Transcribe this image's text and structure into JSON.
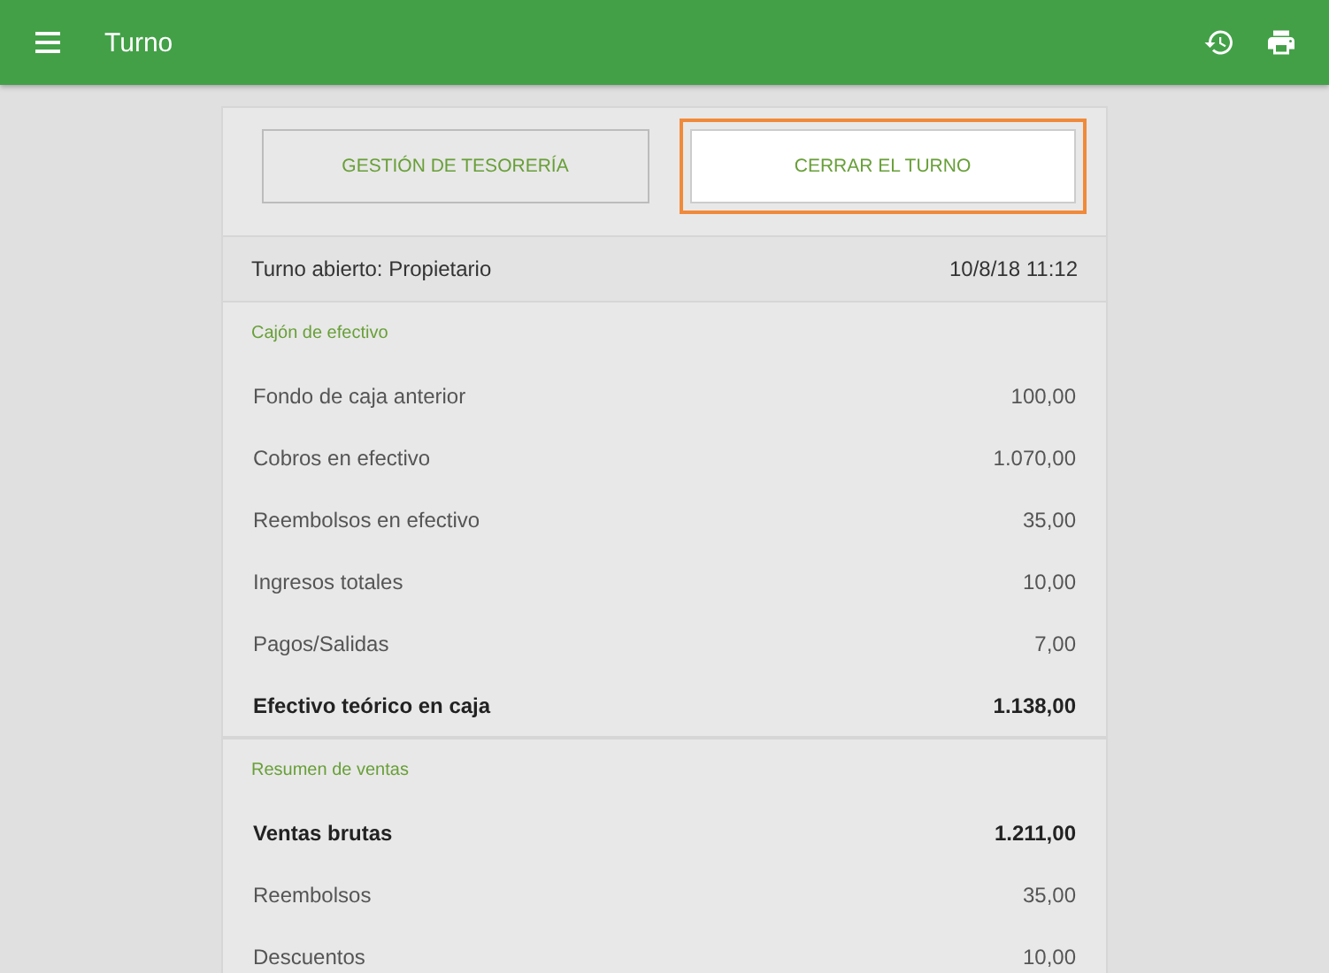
{
  "app_bar": {
    "title": "Turno"
  },
  "actions": [
    {
      "label": "GESTIÓN DE TESORERÍA",
      "highlighted": false
    },
    {
      "label": "CERRAR EL TURNO",
      "highlighted": true
    }
  ],
  "shift": {
    "label": "Turno abierto: Propietario",
    "value": "10/8/18 11:12"
  },
  "sections": [
    {
      "title": "Cajón de efectivo",
      "rows": [
        {
          "label": "Fondo de caja anterior",
          "value": "100,00",
          "bold": false
        },
        {
          "label": "Cobros en efectivo",
          "value": "1.070,00",
          "bold": false
        },
        {
          "label": "Reembolsos en efectivo",
          "value": "35,00",
          "bold": false
        },
        {
          "label": "Ingresos totales",
          "value": "10,00",
          "bold": false
        },
        {
          "label": "Pagos/Salidas",
          "value": "7,00",
          "bold": false
        },
        {
          "label": "Efectivo teórico en caja",
          "value": "1.138,00",
          "bold": true
        }
      ]
    },
    {
      "title": "Resumen de ventas",
      "rows": [
        {
          "label": "Ventas brutas",
          "value": "1.211,00",
          "bold": true
        },
        {
          "label": "Reembolsos",
          "value": "35,00",
          "bold": false
        },
        {
          "label": "Descuentos",
          "value": "10,00",
          "bold": false
        }
      ]
    }
  ]
}
